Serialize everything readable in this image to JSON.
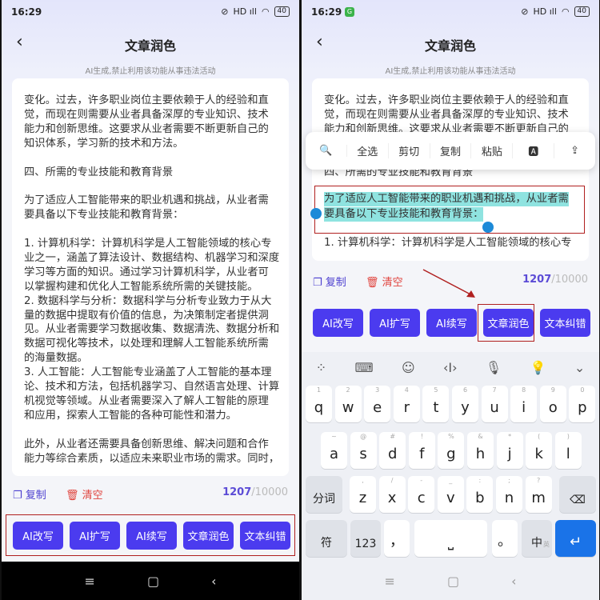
{
  "status": {
    "time": "16:29",
    "battery": "40",
    "signal": "HD ıll",
    "wifi": "wifi-icon",
    "mute": "mute-icon"
  },
  "header": {
    "title": "文章润色",
    "subtitle": "AI生成,禁止利用该功能从事违法活动"
  },
  "article_lines": [
    "变化。过去，许多职业岗位主要依赖于人的经验和直",
    "觉，而现在则需要从业者具备深厚的专业知识、技术",
    "能力和创新思维。这要求从业者需要不断更新自己的",
    "知识体系，学习新的技术和方法。",
    "",
    "四、所需的专业技能和教育背景",
    "",
    "为了适应人工智能带来的职业机遇和挑战，从业者需",
    "要具备以下专业技能和教育背景：",
    "",
    "1. 计算机科学：计算机科学是人工智能领域的核心专",
    "业之一，涵盖了算法设计、数据结构、机器学习和深度",
    "学习等方面的知识。通过学习计算机科学，从业者可",
    "以掌握构建和优化人工智能系统所需的关键技能。",
    "2. 数据科学与分析：数据科学与分析专业致力于从大",
    "量的数据中提取有价值的信息，为决策制定者提供洞",
    "见。从业者需要学习数据收集、数据清洗、数据分析和",
    "数据可视化等技术，以处理和理解人工智能系统所需",
    "的海量数据。",
    "3. 人工智能：人工智能专业涵盖了人工智能的基本理",
    "论、技术和方法，包括机器学习、自然语言处理、计算",
    "机视觉等领域。从业者需要深入了解人工智能的原理",
    "和应用，探索人工智能的各种可能性和潜力。",
    "",
    "此外，从业者还需要具备创新思维、解决问题和合作",
    "能力等综合素质，以适应未来职业市场的需求。同时，"
  ],
  "tools": {
    "copy": "复制",
    "clear": "清空",
    "count": "1207",
    "max": "/10000"
  },
  "buttons": [
    "AI改写",
    "AI扩写",
    "AI续写",
    "文章润色",
    "文本纠错"
  ],
  "popup": [
    "全选",
    "剪切",
    "复制",
    "粘贴"
  ],
  "keyboard": {
    "row1": {
      "keys": [
        "q",
        "w",
        "e",
        "r",
        "t",
        "y",
        "u",
        "i",
        "o",
        "p"
      ],
      "subs": [
        "1",
        "2",
        "3",
        "4",
        "5",
        "6",
        "7",
        "8",
        "9",
        "0"
      ]
    },
    "row2": {
      "keys": [
        "a",
        "s",
        "d",
        "f",
        "g",
        "h",
        "j",
        "k",
        "l"
      ],
      "subs": [
        "~",
        "@",
        "#",
        "!",
        "%",
        "&",
        "*",
        "(",
        ")"
      ]
    },
    "row3": {
      "keys": [
        "z",
        "x",
        "c",
        "v",
        "b",
        "n",
        "m"
      ],
      "subs": [
        ",",
        "/",
        "-",
        "_",
        ":",
        ";",
        "?"
      ]
    },
    "fenci": "分词",
    "fu": "符",
    "num": "123",
    "comma": "，",
    "period": "。",
    "zh": "中",
    "en": "英"
  },
  "colors": {
    "accent": "#4b3bef",
    "enter": "#1a73e8",
    "danger": "#e0443e"
  }
}
